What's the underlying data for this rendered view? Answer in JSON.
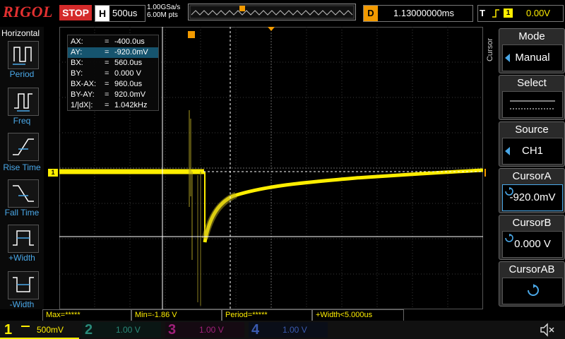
{
  "topbar": {
    "logo": "RIGOL",
    "run_state": "STOP",
    "timebase_key": "H",
    "timebase_value": "500us",
    "sample_rate": "1.00GSa/s",
    "memory_depth": "6.00M pts",
    "delay_key": "D",
    "delay_value": "1.13000000ms",
    "trigger_key": "T",
    "trigger_channel": "1",
    "trigger_level": "0.00V"
  },
  "left_panel": {
    "title": "Horizontal",
    "items": [
      {
        "label": "Period",
        "icon": "period-icon"
      },
      {
        "label": "Freq",
        "icon": "frequency-icon"
      },
      {
        "label": "Rise Time",
        "icon": "rise-time-icon"
      },
      {
        "label": "Fall Time",
        "icon": "fall-time-icon"
      },
      {
        "label": "+Width",
        "icon": "positive-width-icon"
      },
      {
        "label": "-Width",
        "icon": "negative-width-icon"
      }
    ]
  },
  "cursor_info": {
    "rows": [
      {
        "key": "AX:",
        "value": "-400.0us"
      },
      {
        "key": "AY:",
        "value": "-920.0mV"
      },
      {
        "key": "BX:",
        "value": "560.0us"
      },
      {
        "key": "BY:",
        "value": "0.000 V"
      },
      {
        "key": "BX-AX:",
        "value": "960.0us"
      },
      {
        "key": "BY-AY:",
        "value": "920.0mV"
      },
      {
        "key": "1/|dX|:",
        "value": "1.042kHz"
      }
    ]
  },
  "right_panel": {
    "menu_title": "Cursor",
    "mode": {
      "title": "Mode",
      "value": "Manual"
    },
    "select": {
      "title": "Select"
    },
    "source": {
      "title": "Source",
      "value": "CH1"
    },
    "cursor_a": {
      "title": "CursorA",
      "value": "-920.0mV"
    },
    "cursor_b": {
      "title": "CursorB",
      "value": "0.000 V"
    },
    "cursor_ab": {
      "title": "CursorAB"
    }
  },
  "measurements": [
    {
      "text": "Max=*****"
    },
    {
      "text": "Min=-1.86 V"
    },
    {
      "text": "Period=*****"
    },
    {
      "text": "+Width<5.000us"
    }
  ],
  "channels": [
    {
      "num": "1",
      "scale": "500mV",
      "color": "#ffee00",
      "active": true
    },
    {
      "num": "2",
      "scale": "1.00 V",
      "color": "#2a8a7a",
      "active": false
    },
    {
      "num": "3",
      "scale": "1.00 V",
      "color": "#a0207a",
      "active": false
    },
    {
      "num": "4",
      "scale": "1.00 V",
      "color": "#3a5ab0",
      "active": false
    }
  ],
  "markers": {
    "channel_marker": "1",
    "trigger_marker": "T"
  }
}
